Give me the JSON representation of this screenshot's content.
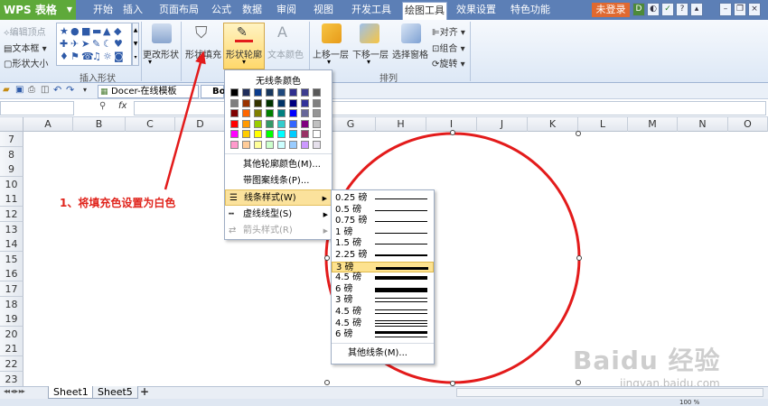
{
  "app": {
    "name": "WPS 表格"
  },
  "tabs": [
    "开始",
    "插入",
    "页面布局",
    "公式",
    "数据",
    "审阅",
    "视图",
    "开发工具",
    "绘图工具",
    "效果设置",
    "特色功能"
  ],
  "active_tab": "绘图工具",
  "login_label": "未登录",
  "ribbon": {
    "edit_points": "编辑顶点",
    "text_box": "文本框",
    "shape_size": "形状大小",
    "insert_shapes_group": "插入形状",
    "change_shape": "更改形状",
    "fill": "形状填充",
    "outline": "形状轮廓",
    "text_color": "文本颜色",
    "bring_forward": "上移一层",
    "send_backward": "下移一层",
    "selection_pane": "选择窗格",
    "align": "对齐",
    "group": "组合",
    "rotate": "旋转",
    "arrange_group": "排列"
  },
  "doc_tab": "Docer-在线模板",
  "doc_tab2": "Bo",
  "formula_bar": {
    "fx": "fx"
  },
  "columns": [
    "A",
    "B",
    "C",
    "D",
    "E",
    "F",
    "G",
    "H",
    "I",
    "J",
    "K",
    "L",
    "M",
    "N",
    "O"
  ],
  "rows": [
    "7",
    "8",
    "9",
    "10",
    "11",
    "12",
    "13",
    "14",
    "15",
    "16",
    "17",
    "18",
    "19",
    "20",
    "21",
    "22",
    "23"
  ],
  "color_menu": {
    "no_line": "无线条颜色",
    "more_colors": "其他轮廓颜色(M)...",
    "pattern": "带图案线条(P)...",
    "line_style": "线条样式(W)",
    "dash_style": "虚线线型(S)",
    "arrow_style": "箭头样式(R)"
  },
  "palette": [
    [
      "#000000",
      "#1f2d5a",
      "#0b3b8c",
      "#17365d",
      "#1f497d",
      "#2f2f8f",
      "#3d3d8f",
      "#595959"
    ],
    [
      "#7f7f7f",
      "#993300",
      "#333300",
      "#003300",
      "#003366",
      "#000080",
      "#333399",
      "#808080"
    ],
    [
      "#800000",
      "#ff6600",
      "#808000",
      "#008000",
      "#008080",
      "#0000ff",
      "#666699",
      "#969696"
    ],
    [
      "#ff0000",
      "#ff9900",
      "#99cc00",
      "#339966",
      "#33cccc",
      "#3366ff",
      "#800080",
      "#c0c0c0"
    ],
    [
      "#ff00ff",
      "#ffcc00",
      "#ffff00",
      "#00ff00",
      "#00ffff",
      "#00ccff",
      "#993366",
      "#ffffff"
    ],
    [
      "#ff99cc",
      "#ffcc99",
      "#ffff99",
      "#ccffcc",
      "#ccffff",
      "#99ccff",
      "#cc99ff",
      "#e6e0ec"
    ]
  ],
  "line_styles": [
    {
      "label": "0.25 磅",
      "weight": 0.25
    },
    {
      "label": "0.5 磅",
      "weight": 0.5
    },
    {
      "label": "0.75 磅",
      "weight": 0.75
    },
    {
      "label": "1 磅",
      "weight": 1
    },
    {
      "label": "1.5 磅",
      "weight": 1.5
    },
    {
      "label": "2.25 磅",
      "weight": 2.25
    },
    {
      "label": "3 磅",
      "weight": 3,
      "selected": true
    },
    {
      "label": "4.5 磅",
      "weight": 4.5
    },
    {
      "label": "6 磅",
      "weight": 6
    },
    {
      "label": "3 磅",
      "weight": 3,
      "compound": "double"
    },
    {
      "label": "4.5 磅",
      "weight": 4.5,
      "compound": "double"
    },
    {
      "label": "4.5 磅",
      "weight": 4.5,
      "compound": "triple"
    },
    {
      "label": "6 磅",
      "weight": 6,
      "compound": "thick-thin"
    }
  ],
  "more_lines": "其他线条(M)...",
  "annotation": "1、将填充色设置为白色",
  "sheets": [
    "Sheet1",
    "Sheet5"
  ],
  "add_sheet": "+",
  "status": {
    "zoom": "100 %"
  },
  "watermark": {
    "text": "Baidu 经验",
    "url": "jingyan.baidu.com"
  },
  "colors": {
    "circle": "#e31b1b",
    "annotation": "#e0241c",
    "highlight": "#fbe29c"
  }
}
